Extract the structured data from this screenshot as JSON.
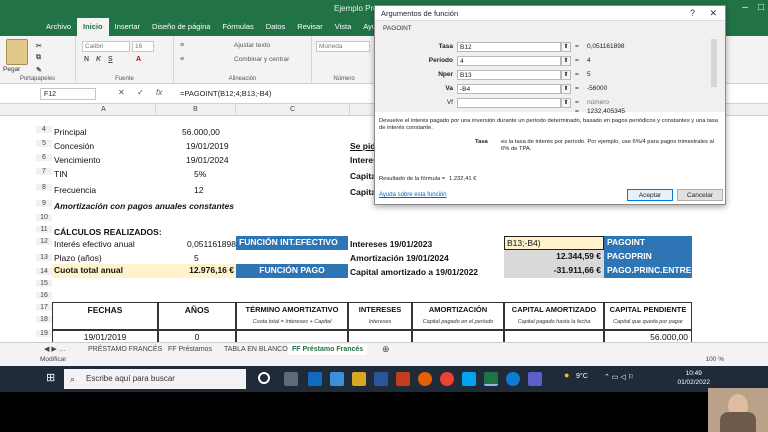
{
  "window": {
    "title": "Ejemplo Prést"
  },
  "menu": {
    "tabs": [
      "Archivo",
      "Inicio",
      "Insertar",
      "Diseño de página",
      "Fórmulas",
      "Datos",
      "Revisar",
      "Vista",
      "Ayuda"
    ],
    "active_index": 1
  },
  "ribbon": {
    "paste": "Pegar",
    "clipboard": "Portapapeles",
    "font_name": "Calibri",
    "font_size": "16",
    "font_group": "Fuente",
    "wrap_text": "Ajustar texto",
    "merge": "Combinar y centrar",
    "alignment_group": "Alineación",
    "number_format": "Moneda",
    "number_group": "Número"
  },
  "formula_bar": {
    "name_box": "F12",
    "cancel": "✕",
    "enter": "✓",
    "fx": "fx",
    "formula": "=PAGOINT(B12;4;B13;-B4)"
  },
  "columns": [
    "A",
    "B",
    "C",
    "D",
    "E",
    "F"
  ],
  "rows": [
    "4",
    "5",
    "6",
    "7",
    "8",
    "9",
    "10",
    "11",
    "12",
    "13",
    "14",
    "15",
    "16",
    "17",
    "18",
    "19"
  ],
  "sheet": {
    "a4": "Principal",
    "b4": "56.000,00",
    "a5": "Concesión",
    "b5": "19/01/2019",
    "a6": "Vencimiento",
    "b6": "19/01/2024",
    "a7": "TIN",
    "b7": "5%",
    "a8": "Frecuencia",
    "b8": "12",
    "a9": "Amortización con pagos anuales constantes",
    "a11": "CÁLCULOS REALIZADOS:",
    "a12": "Interés efectivo anual",
    "b12": "0,051161898",
    "c12": "FUNCIÓN INT.EFECTIVO",
    "a13": "Plazo (años)",
    "b13": "5",
    "a14": "Cuota total anual",
    "b14": "12.976,16 €",
    "c14": "FUNCIÓN PAGO",
    "d5": "Se pid",
    "d6": "Interes",
    "d7": "Capita",
    "d8": "Capita",
    "d12": "Intereses 19/01/2023",
    "e12": "B13;-B4)",
    "f12": "PAGOINT",
    "d13": "Amortización 19/01/2024",
    "e13": "12.344,59 €",
    "f13": "PAGOPRIN",
    "d14": "Capital amortizado a 19/01/2022",
    "e14": "-31.911,66 €",
    "f14": "PAGO.PRINC.ENTRE",
    "headers": [
      "FECHAS",
      "AÑOS",
      "TÉRMINO AMORTIZATIVO",
      "INTERESES",
      "AMORTIZACIÓN",
      "CAPITAL AMORTIZADO",
      "CAPITAL PENDIENTE"
    ],
    "subheaders": [
      "Cuota total = Intereses + Capital",
      "Intereses",
      "Capital pagado en el período",
      "Capital pagado hasta la fecha",
      "Capital que queda por pagar"
    ],
    "a19": "19/01/2019",
    "b19": "0",
    "g19": "56.000,00"
  },
  "sheet_tabs": [
    "PRÉSTAMO FRANCÉS",
    "FF Préstamos",
    "TABLA EN BLANCO",
    "FF Préstamo Francés"
  ],
  "active_sheet_index": 3,
  "status": {
    "mode": "Modificar",
    "zoom": "100 %"
  },
  "dialog": {
    "title": "Argumentos de función",
    "help": "?",
    "close": "✕",
    "function": "PAGOINT",
    "args": [
      {
        "label": "Tasa",
        "field": "B12",
        "value": "0,051161898"
      },
      {
        "label": "Período",
        "field": "4",
        "value": "4"
      },
      {
        "label": "Nper",
        "field": "B13",
        "value": "5"
      },
      {
        "label": "Va",
        "field": "-B4",
        "value": "-56000"
      },
      {
        "label": "Vf",
        "field": "",
        "value": "número"
      }
    ],
    "result_preview": "1232,405345",
    "description": "Devuelve el interés pagado por una inversión durante un período determinado, basado en pagos periódicos y constantes y una tasa de interés constante.",
    "arg_name": "Tasa",
    "arg_desc": "es la tasa de interés por período. Por ejemplo, use 6%/4 para pagos trimestrales al 6% de TPA.",
    "result_label": "Resultado de la fórmula =",
    "result_value": "1.232,41 €",
    "help_link": "Ayuda sobre esta función",
    "ok": "Aceptar",
    "cancel": "Cancelar"
  },
  "taskbar": {
    "search": "Escribe aquí para buscar",
    "temp": "9°C",
    "time": "10:49",
    "date": "01/02/2022"
  }
}
